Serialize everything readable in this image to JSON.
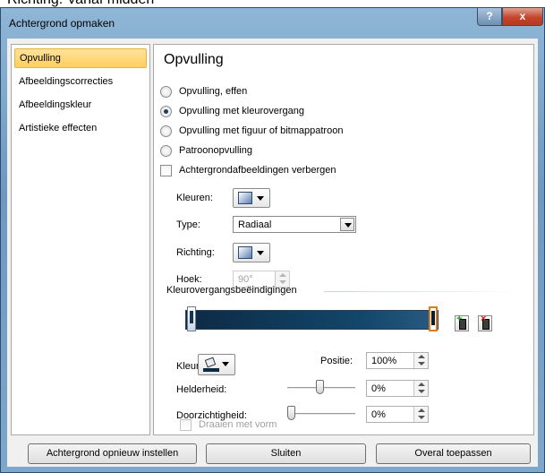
{
  "top_strip_text": "Richting: Vanaf midden",
  "window": {
    "title": "Achtergrond opmaken",
    "help_label": "?",
    "close_label": "x"
  },
  "sidebar": {
    "items": [
      {
        "label": "Opvulling",
        "selected": true
      },
      {
        "label": "Afbeeldingscorrecties",
        "selected": false
      },
      {
        "label": "Afbeeldingskleur",
        "selected": false
      },
      {
        "label": "Artistieke effecten",
        "selected": false
      }
    ]
  },
  "panel": {
    "title": "Opvulling",
    "fill_options": [
      {
        "label": "Opvulling, effen",
        "checked": false
      },
      {
        "label": "Opvulling met kleurovergang",
        "checked": true
      },
      {
        "label": "Opvulling met figuur of bitmappatroon",
        "checked": false
      },
      {
        "label": "Patroonopvulling",
        "checked": false
      }
    ],
    "hide_background_label": "Achtergrondafbeeldingen verbergen",
    "hide_background_checked": false,
    "colors_label": "Kleuren:",
    "type_label": "Type:",
    "type_value": "Radiaal",
    "direction_label": "Richting:",
    "angle_label": "Hoek:",
    "angle_value": "90°",
    "gradient_stops_label": "Kleurovergangsbeëindigingen",
    "color_label": "Kleur",
    "position_label": "Positie:",
    "position_value": "100%",
    "brightness_label": "Helderheid:",
    "brightness_value": "0%",
    "brightness_level": 0,
    "transparency_label": "Doorzichtigheid:",
    "transparency_value": "0%",
    "transparency_level": 0,
    "rotate_label": "Draaien met vorm",
    "rotate_checked": false
  },
  "footer": {
    "reset_label": "Achtergrond opnieuw instellen",
    "close_label": "Sluiten",
    "apply_all_label": "Overal toepassen"
  },
  "colors": {
    "title_gradient": "#7fa7cb",
    "selection": "#ffcf5e",
    "gradient_dark": "#0d2a44",
    "gradient_mid": "#12476b",
    "active_stop_border": "#e07a1f",
    "close_button": "#c4452b"
  }
}
